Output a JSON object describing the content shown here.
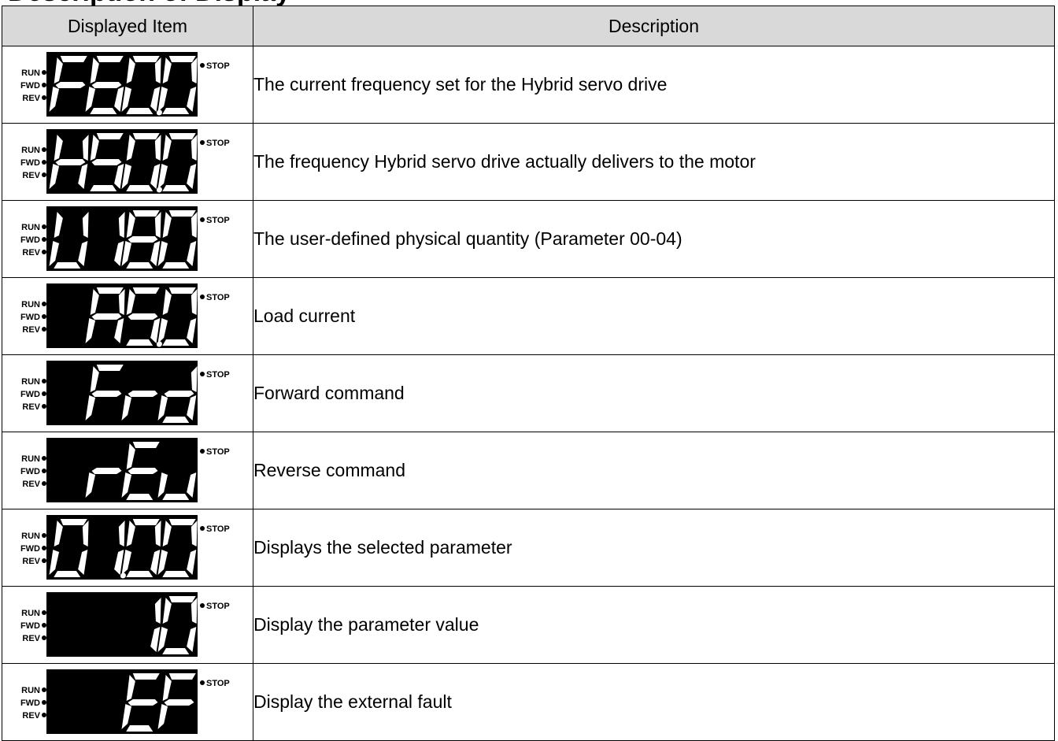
{
  "title": "Description of Display",
  "table": {
    "headers": [
      "Displayed Item",
      "Description"
    ],
    "indicators": {
      "run": "RUN",
      "fwd": "FWD",
      "rev": "REV",
      "stop": "STOP"
    },
    "rows": [
      {
        "display": "F60.0",
        "description": "The current frequency set for the Hybrid servo drive"
      },
      {
        "display": "H50.0",
        "description": "The frequency Hybrid servo drive actually delivers to the motor"
      },
      {
        "display": "U180",
        "description": "The user-defined physical quantity (Parameter 00-04)"
      },
      {
        "display": "A5.0",
        "description": "Load current"
      },
      {
        "display": "Frd",
        "description": "Forward command"
      },
      {
        "display": "rEv",
        "description": "Reverse command"
      },
      {
        "display": "01.00",
        "description": "Displays the selected parameter"
      },
      {
        "display": "10",
        "description": "Display the parameter value"
      },
      {
        "display": "EF",
        "description": "Display the external fault"
      }
    ]
  }
}
